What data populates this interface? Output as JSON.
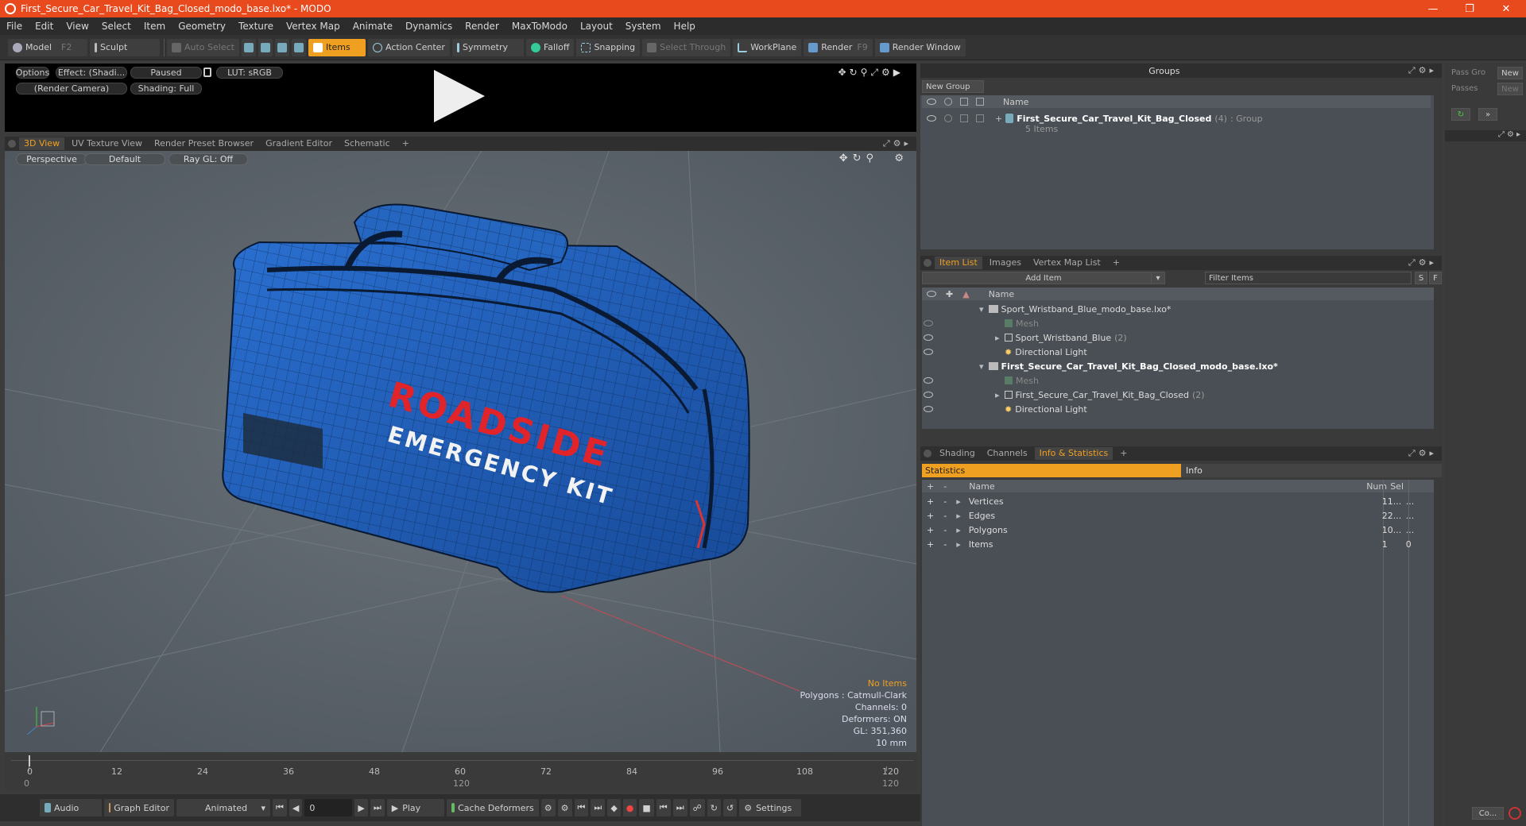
{
  "window": {
    "title": "First_Secure_Car_Travel_Kit_Bag_Closed_modo_base.lxo* - MODO"
  },
  "menu": [
    "File",
    "Edit",
    "View",
    "Select",
    "Item",
    "Geometry",
    "Texture",
    "Vertex Map",
    "Animate",
    "Dynamics",
    "Render",
    "MaxToModo",
    "Layout",
    "System",
    "Help"
  ],
  "toolbar": {
    "model": "Model",
    "model_key": "F2",
    "sculpt": "Sculpt",
    "auto_select": "Auto Select",
    "items": "Items",
    "action_center": "Action Center",
    "symmetry": "Symmetry",
    "falloff": "Falloff",
    "snapping": "Snapping",
    "select_through": "Select Through",
    "workplane": "WorkPlane",
    "render": "Render",
    "render_key": "F9",
    "render_window": "Render Window"
  },
  "preview": {
    "options": "Options",
    "effect": "Effect: (Shadi...",
    "paused": "Paused",
    "lut": "LUT: sRGB",
    "camera": "(Render Camera)",
    "shading": "Shading: Full"
  },
  "viewport_tabs": [
    "3D View",
    "UV Texture View",
    "Render Preset Browser",
    "Gradient Editor",
    "Schematic",
    "+"
  ],
  "viewport": {
    "perspective": "Perspective",
    "default": "Default",
    "raygl": "Ray GL: Off"
  },
  "bag": {
    "line1": "ROADSIDE",
    "line2": "EMERGENCY KIT"
  },
  "overlay": {
    "no_items": "No Items",
    "polygons": "Polygons : Catmull-Clark",
    "channels": "Channels: 0",
    "deformers": "Deformers: ON",
    "gl": "GL: 351,360",
    "scale": "10 mm"
  },
  "timeline": {
    "ticks": [
      "0",
      "12",
      "24",
      "36",
      "48",
      "60",
      "72",
      "84",
      "96",
      "108",
      "120"
    ],
    "start": "0",
    "mid": "120",
    "end": "120"
  },
  "bottom": {
    "audio": "Audio",
    "graph_editor": "Graph Editor",
    "animated": "Animated",
    "frame": "0",
    "play": "Play",
    "cache": "Cache Deformers",
    "settings": "Settings"
  },
  "groups": {
    "title": "Groups",
    "new_group": "New Group",
    "col_name": "Name",
    "item_name": "First_Secure_Car_Travel_Kit_Bag_Closed",
    "item_count": "(4)",
    "item_type": ": Group",
    "item_sub": "5 Items"
  },
  "itemlist": {
    "tabs": [
      "Item List",
      "Images",
      "Vertex Map List",
      "+"
    ],
    "add_item": "Add Item",
    "filter": "Filter Items",
    "col_name": "Name",
    "rows": [
      {
        "name": "Sport_Wristband_Blue_modo_base.lxo*",
        "bold": false
      },
      {
        "name": "Mesh",
        "dim": true
      },
      {
        "name": "Sport_Wristband_Blue",
        "extra": "(2)"
      },
      {
        "name": "Directional Light"
      },
      {
        "name": "First_Secure_Car_Travel_Kit_Bag_Closed_modo_base.lxo*",
        "bold": true
      },
      {
        "name": "Mesh",
        "dim": true
      },
      {
        "name": "First_Secure_Car_Travel_Kit_Bag_Closed",
        "extra": "(2)"
      },
      {
        "name": "Directional Light"
      }
    ]
  },
  "info": {
    "tabs": [
      "Shading",
      "Channels",
      "Info & Statistics",
      "+"
    ],
    "statistics": "Statistics",
    "info": "Info",
    "cols": {
      "name": "Name",
      "num": "Num",
      "sel": "Sel"
    },
    "rows": [
      {
        "name": "Vertices",
        "num": "11...",
        "sel": "..."
      },
      {
        "name": "Edges",
        "num": "22...",
        "sel": "..."
      },
      {
        "name": "Polygons",
        "num": "10...",
        "sel": "..."
      },
      {
        "name": "Items",
        "num": "1",
        "sel": "0"
      }
    ]
  },
  "passes": {
    "pass_gro": "Pass Gro",
    "passes": "Passes",
    "new1": "New",
    "new2": "New",
    "co": "Co..."
  },
  "colors": {
    "title_bar": "#e8491d",
    "accent": "#f0a020",
    "bag_blue": "#1f5bb5",
    "bag_red": "#e0242a"
  }
}
